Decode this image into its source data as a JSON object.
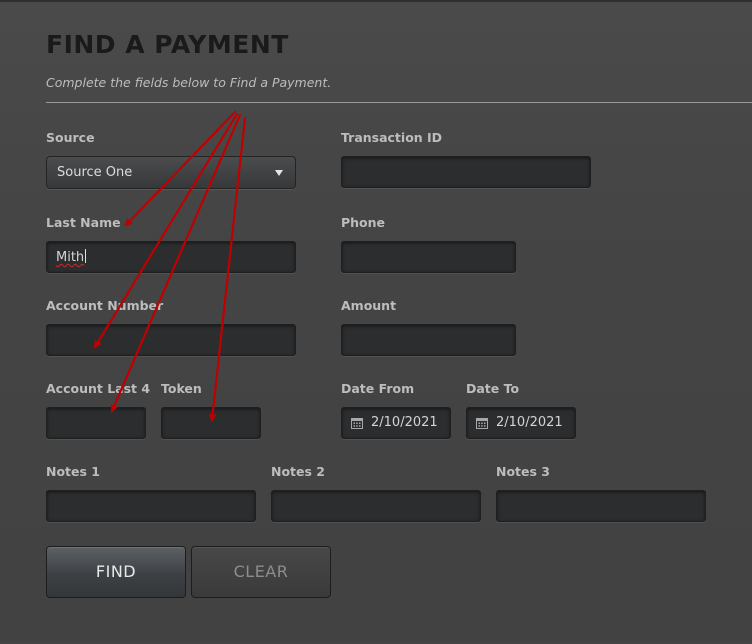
{
  "header": {
    "title": "FIND A PAYMENT",
    "subtitle": "Complete the fields below to Find a Payment."
  },
  "form": {
    "source": {
      "label": "Source",
      "value": "Source One"
    },
    "transaction_id": {
      "label": "Transaction ID",
      "value": ""
    },
    "last_name": {
      "label": "Last Name",
      "value": "Mith"
    },
    "phone": {
      "label": "Phone",
      "value": ""
    },
    "account_number": {
      "label": "Account Number",
      "value": ""
    },
    "amount": {
      "label": "Amount",
      "value": ""
    },
    "account_last4": {
      "label": "Account Last 4",
      "value": ""
    },
    "token": {
      "label": "Token",
      "value": ""
    },
    "date_from": {
      "label": "Date From",
      "value": "2/10/2021"
    },
    "date_to": {
      "label": "Date To",
      "value": "2/10/2021"
    },
    "notes1": {
      "label": "Notes 1",
      "value": ""
    },
    "notes2": {
      "label": "Notes 2",
      "value": ""
    },
    "notes3": {
      "label": "Notes 3",
      "value": ""
    }
  },
  "buttons": {
    "find": "FIND",
    "clear": "CLEAR"
  },
  "icons": {
    "source_dropdown": "chevron-down-icon",
    "date_picker": "calendar-icon"
  },
  "colors": {
    "background": "#454545",
    "field": "#2b2d2f",
    "annotation_arrow": "#c00000"
  }
}
